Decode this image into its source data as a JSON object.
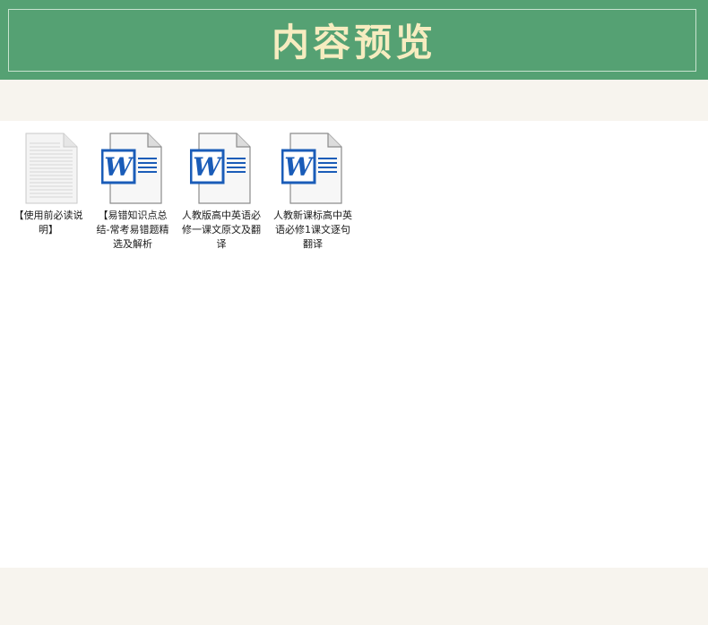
{
  "banner": {
    "title": "内容预览"
  },
  "colors": {
    "banner_bg": "#55a173",
    "title_text": "#f6ecc0",
    "word_blue": "#1a5cb8",
    "page_bg": "#f7f4ee"
  },
  "files": [
    {
      "name": "【使用前必读说明】",
      "icon": "text-document-icon"
    },
    {
      "name": "【易错知识点总结-常考易错题精选及解析",
      "icon": "word-document-icon"
    },
    {
      "name": "人教版高中英语必修一课文原文及翻译",
      "icon": "word-document-icon"
    },
    {
      "name": "人教新课标高中英语必修1课文逐句翻译",
      "icon": "word-document-icon"
    }
  ]
}
